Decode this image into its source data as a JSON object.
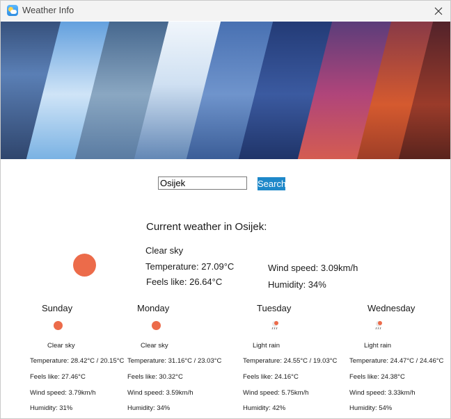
{
  "window": {
    "title": "Weather Info"
  },
  "search": {
    "value": "Osijek",
    "button_label": "Search"
  },
  "current": {
    "heading": "Current weather in Osijek:",
    "description": "Clear sky",
    "temperature": "Temperature: 27.09°C",
    "feels_like": "Feels like: 26.64°C",
    "wind_speed": "Wind speed: 3.09km/h",
    "humidity": "Humidity: 34%",
    "icon": "sun-icon"
  },
  "forecast": [
    {
      "day": "Sunday",
      "icon": "sun-icon",
      "description": "Clear sky",
      "temperature": "Temperature: 28.42°C / 20.15°C",
      "feels_like": "Feels like: 27.46°C",
      "wind_speed": "Wind speed: 3.79km/h",
      "humidity": "Humidity: 31%"
    },
    {
      "day": "Monday",
      "icon": "sun-icon",
      "description": "Clear sky",
      "temperature": "Temperature: 31.16°C / 23.03°C",
      "feels_like": "Feels like: 30.32°C",
      "wind_speed": "Wind speed: 3.59km/h",
      "humidity": "Humidity: 34%"
    },
    {
      "day": "Tuesday",
      "icon": "rain-icon",
      "description": "Light rain",
      "temperature": "Temperature: 24.55°C / 19.03°C",
      "feels_like": "Feels like: 24.16°C",
      "wind_speed": "Wind speed: 5.75km/h",
      "humidity": "Humidity: 42%"
    },
    {
      "day": "Wednesday",
      "icon": "rain-icon",
      "description": "Light rain",
      "temperature": "Temperature: 24.47°C / 24.46°C",
      "feels_like": "Feels like: 24.38°C",
      "wind_speed": "Wind speed: 3.33km/h",
      "humidity": "Humidity: 54%"
    }
  ],
  "colors": {
    "accent": "#1e88c9",
    "sun": "#ec6b4a"
  }
}
